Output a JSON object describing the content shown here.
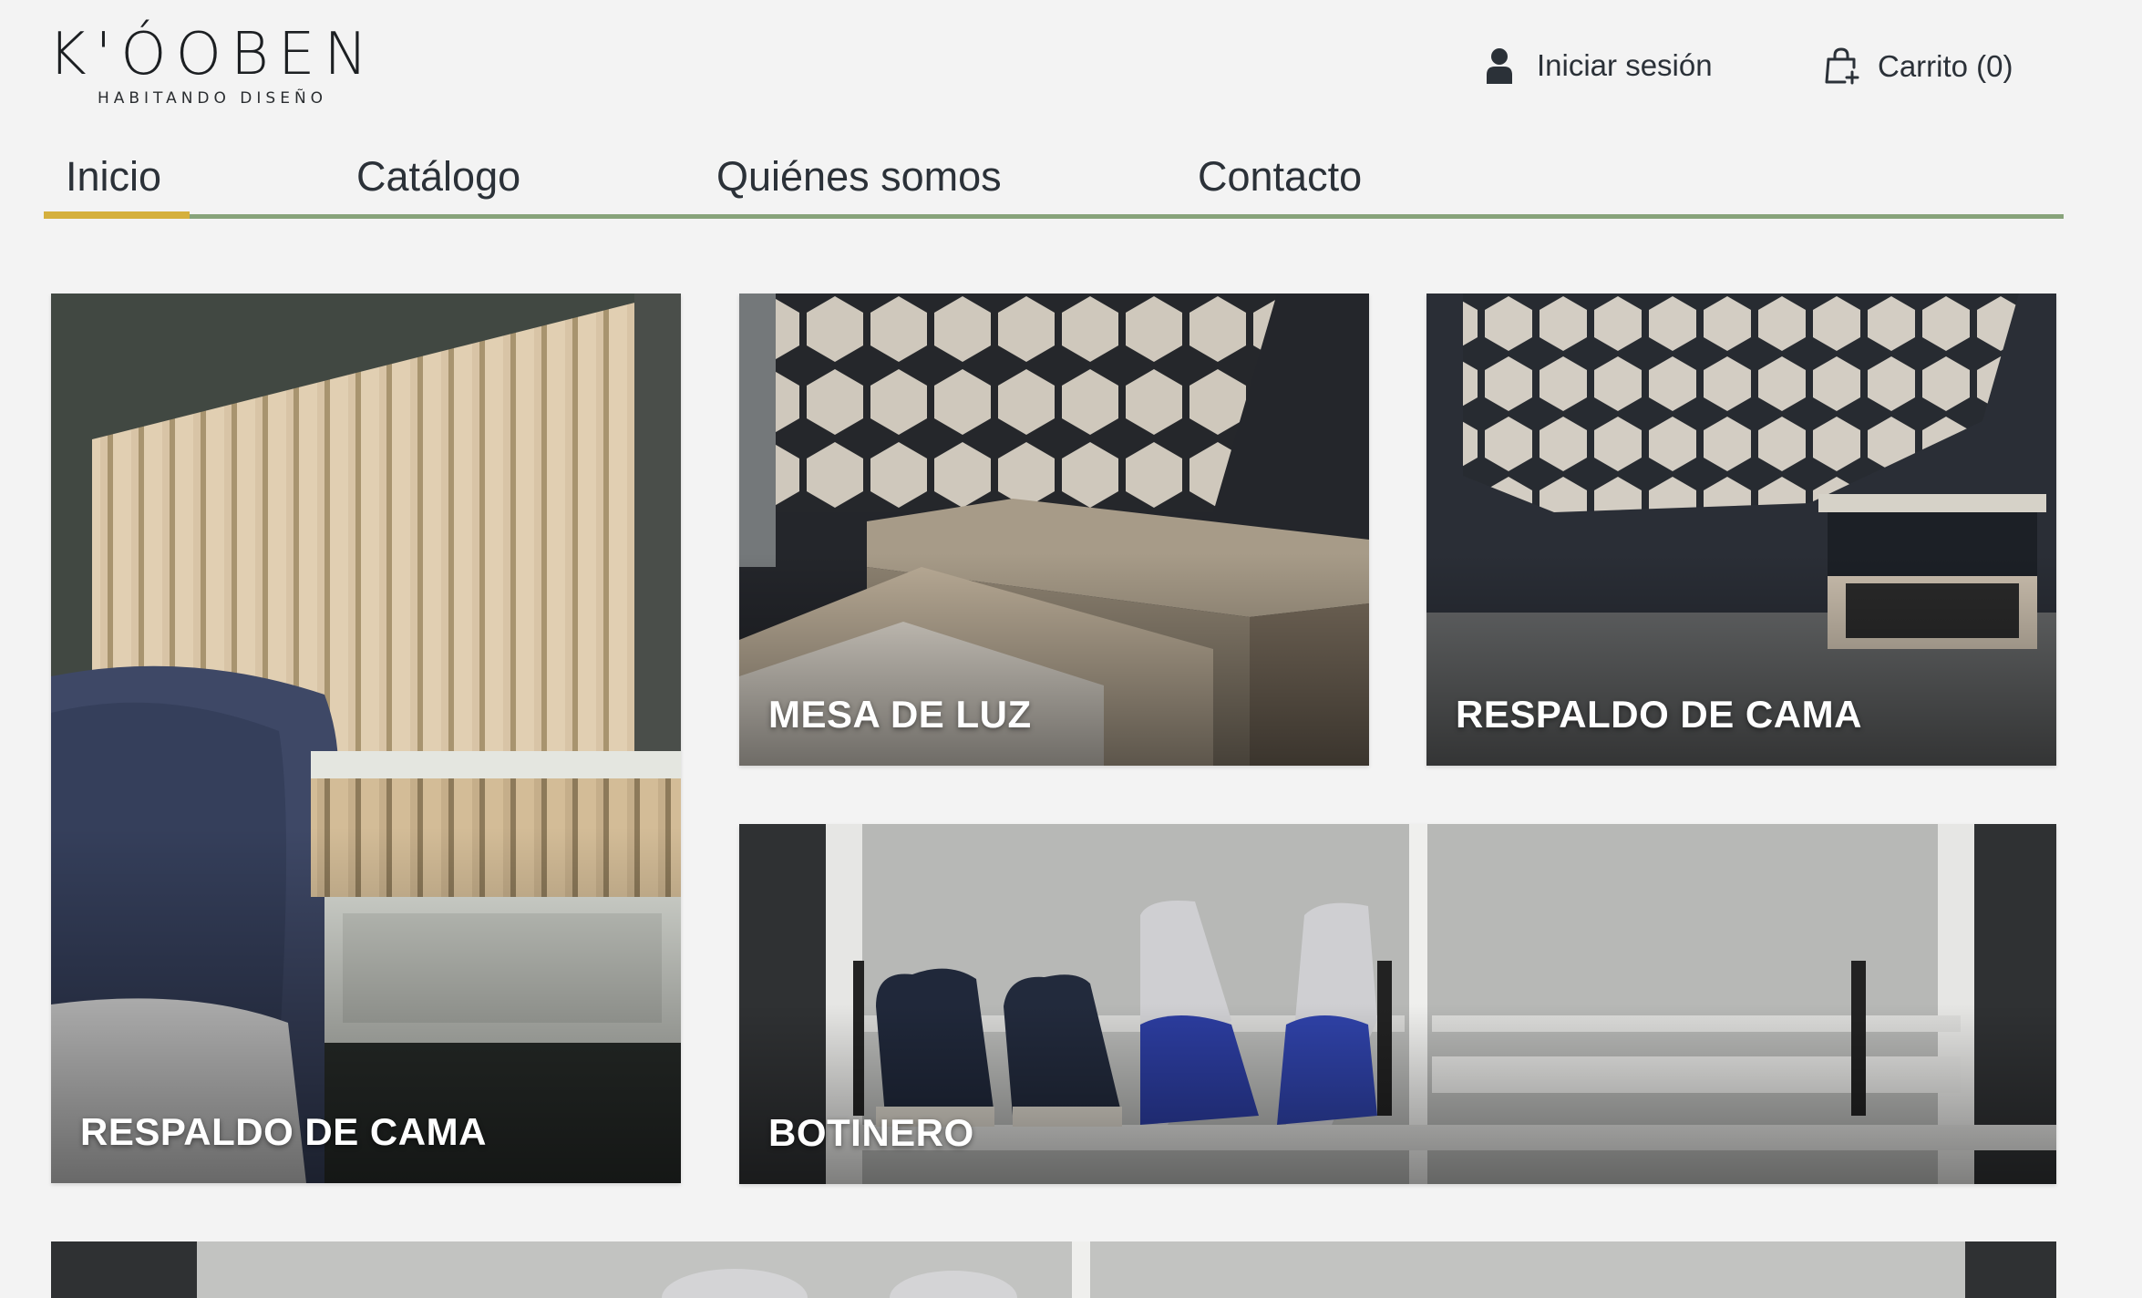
{
  "brand": {
    "name": "K'ÓOBEN",
    "tagline": "HABITANDO DISEÑO"
  },
  "header": {
    "login_label": "Iniciar sesión",
    "login_icon": "user-icon",
    "cart_label": "Carrito (0)",
    "cart_icon": "shopping-bag-plus-icon"
  },
  "nav": {
    "items": [
      {
        "label": "Inicio",
        "active": true
      },
      {
        "label": "Catálogo",
        "active": false
      },
      {
        "label": "Quiénes somos",
        "active": false
      },
      {
        "label": "Contacto",
        "active": false
      }
    ],
    "line_color": "#87a37a",
    "active_color": "#d5b03e"
  },
  "tiles": [
    {
      "caption": "RESPALDO DE CAMA"
    },
    {
      "caption": "MESA DE LUZ"
    },
    {
      "caption": "RESPALDO DE CAMA"
    },
    {
      "caption": "BOTINERO"
    },
    {
      "caption": ""
    }
  ]
}
